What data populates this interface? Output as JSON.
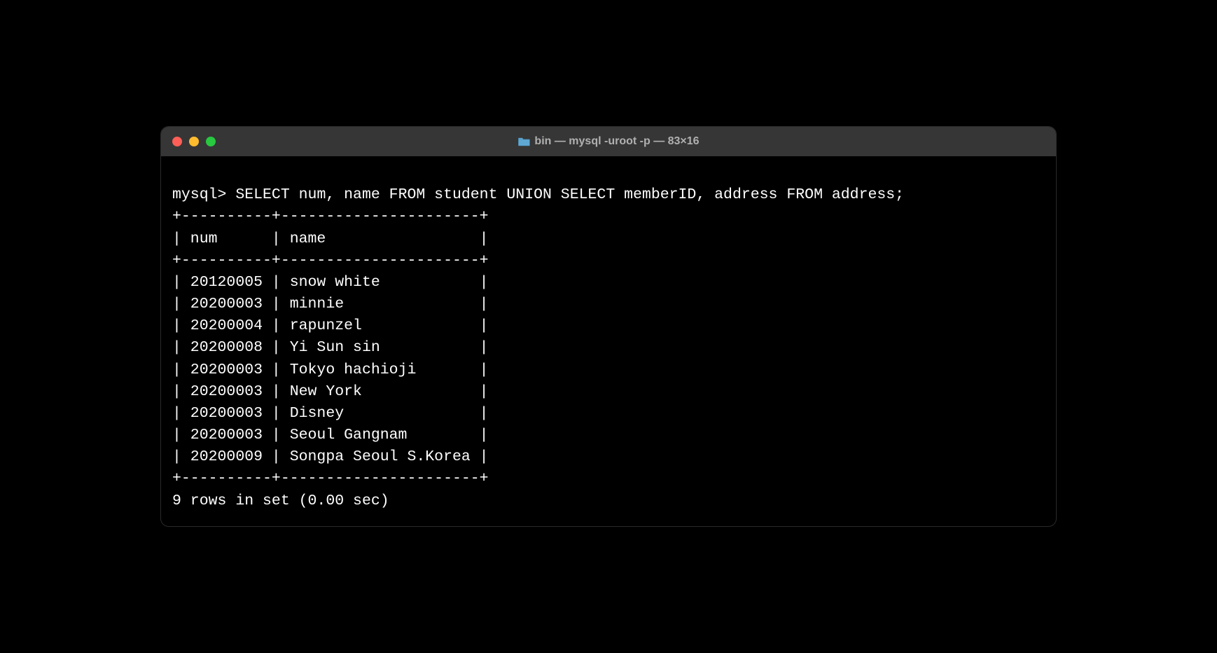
{
  "window": {
    "title": "bin — mysql -uroot -p — 83×16"
  },
  "terminal": {
    "prompt": "mysql>",
    "query": "SELECT num, name FROM student UNION SELECT memberID, address FROM address;",
    "table": {
      "border_top": "+----------+----------------------+",
      "header": "| num      | name                 |",
      "border_mid": "+----------+----------------------+",
      "rows": [
        "| 20120005 | snow white           |",
        "| 20200003 | minnie               |",
        "| 20200004 | rapunzel             |",
        "| 20200008 | Yi Sun sin           |",
        "| 20200003 | Tokyo hachioji       |",
        "| 20200003 | New York             |",
        "| 20200003 | Disney               |",
        "| 20200003 | Seoul Gangnam        |",
        "| 20200009 | Songpa Seoul S.Korea |"
      ],
      "border_bot": "+----------+----------------------+"
    },
    "footer": "9 rows in set (0.00 sec)",
    "columns": [
      "num",
      "name"
    ],
    "data": [
      {
        "num": "20120005",
        "name": "snow white"
      },
      {
        "num": "20200003",
        "name": "minnie"
      },
      {
        "num": "20200004",
        "name": "rapunzel"
      },
      {
        "num": "20200008",
        "name": "Yi Sun sin"
      },
      {
        "num": "20200003",
        "name": "Tokyo hachioji"
      },
      {
        "num": "20200003",
        "name": "New York"
      },
      {
        "num": "20200003",
        "name": "Disney"
      },
      {
        "num": "20200003",
        "name": "Seoul Gangnam"
      },
      {
        "num": "20200009",
        "name": "Songpa Seoul S.Korea"
      }
    ]
  }
}
